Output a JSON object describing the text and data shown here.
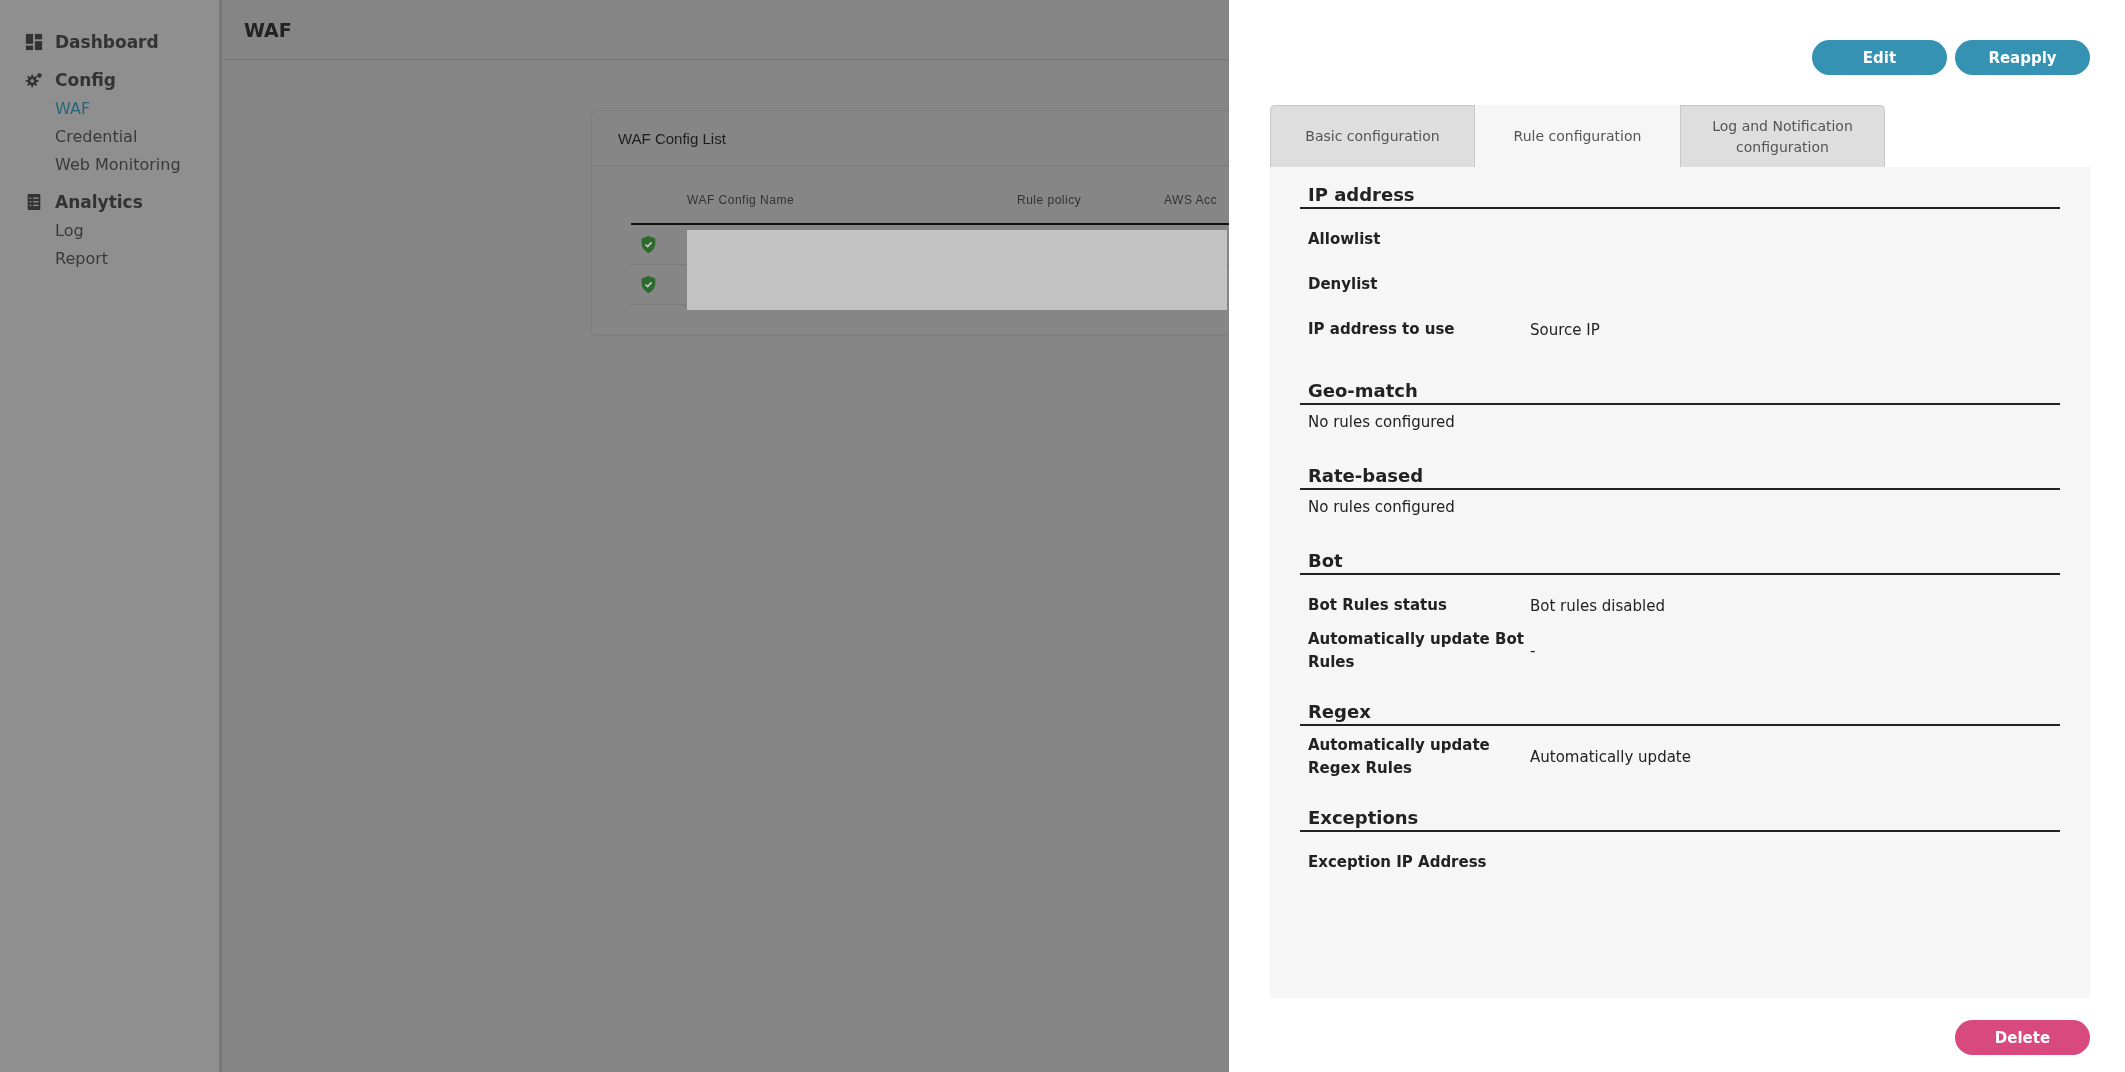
{
  "sidebar": {
    "groups": [
      {
        "label": "Dashboard"
      },
      {
        "label": "Config",
        "items": [
          {
            "label": "WAF",
            "selected": true
          },
          {
            "label": "Credential",
            "selected": false
          },
          {
            "label": "Web Monitoring",
            "selected": false
          }
        ]
      },
      {
        "label": "Analytics",
        "items": [
          {
            "label": "Log",
            "selected": false
          },
          {
            "label": "Report",
            "selected": false
          }
        ]
      }
    ]
  },
  "header": {
    "title": "WAF"
  },
  "config_list": {
    "title": "WAF Config List",
    "columns": [
      "WAF Config Name",
      "Rule policy",
      "AWS Acc"
    ],
    "rows": [
      {
        "kind": "protected"
      },
      {
        "kind": "protected"
      }
    ],
    "redacted": true
  },
  "drawer": {
    "buttons": [
      "Edit",
      "Reapply"
    ],
    "tabs": [
      {
        "label": "Basic configuration",
        "selected": false
      },
      {
        "label": "Rule configuration",
        "selected": true
      },
      {
        "label": "Log and Notification configuration",
        "selected": false
      }
    ],
    "sections": [
      {
        "title": "IP address",
        "kind": "fields",
        "rows": [
          {
            "label": "Allowlist",
            "value": ""
          },
          {
            "label": "Denylist",
            "value": ""
          },
          {
            "label": "IP address to use",
            "value": "Source IP"
          }
        ]
      },
      {
        "title": "Geo-match",
        "kind": "message",
        "message": "No rules configured"
      },
      {
        "title": "Rate-based",
        "kind": "message",
        "message": "No rules configured"
      },
      {
        "title": "Bot",
        "kind": "fields",
        "rows": [
          {
            "label": "Bot Rules status",
            "value": "Bot rules disabled"
          },
          {
            "label": "Automatically update Bot Rules",
            "value": "-"
          }
        ]
      },
      {
        "title": "Regex",
        "kind": "fields",
        "rows": [
          {
            "label": "Automatically update Regex Rules",
            "value": "Automatically update"
          }
        ]
      },
      {
        "title": "Exceptions",
        "kind": "fields",
        "rows": [
          {
            "label": "Exception IP Address",
            "value": ""
          }
        ]
      }
    ],
    "delete_button": "Delete"
  }
}
